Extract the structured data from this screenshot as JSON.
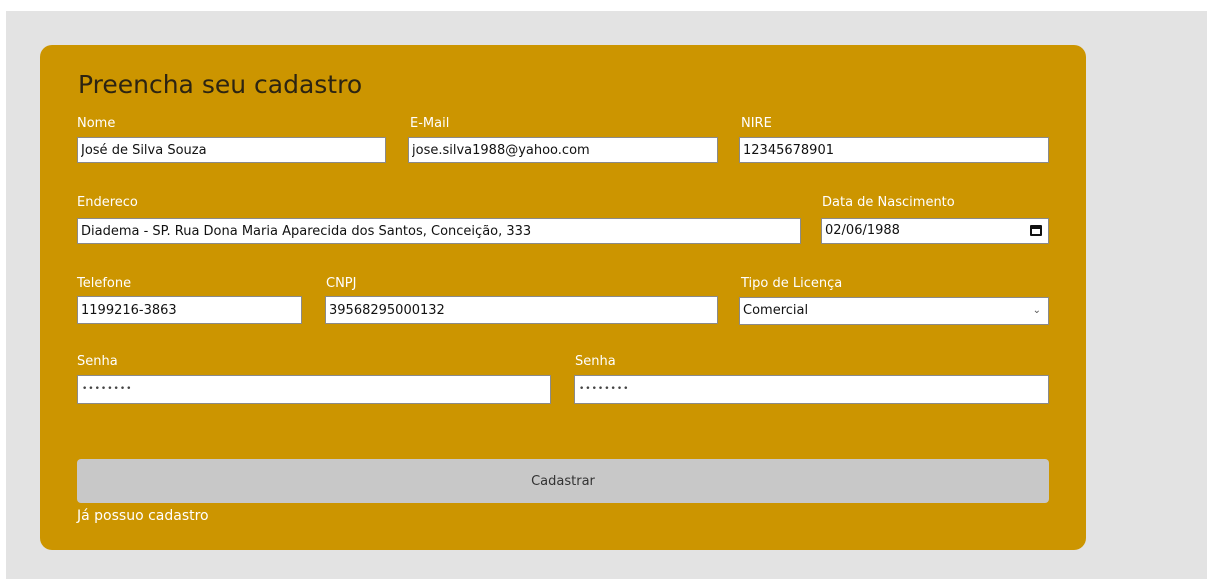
{
  "form": {
    "title": "Preencha seu cadastro",
    "fields": {
      "nome": {
        "label": "Nome",
        "value": "José de Silva Souza"
      },
      "email": {
        "label": "E-Mail",
        "value": "jose.silva1988@yahoo.com"
      },
      "nire": {
        "label": "NIRE",
        "value": "12345678901"
      },
      "endereco": {
        "label": "Endereco",
        "value": "Diadema - SP. Rua Dona Maria Aparecida dos Santos, Conceição, 333"
      },
      "nascimento": {
        "label": "Data de Nascimento",
        "value": "02/06/1988"
      },
      "telefone": {
        "label": "Telefone",
        "value": "1199216-3863"
      },
      "cnpj": {
        "label": "CNPJ",
        "value": "39568295000132"
      },
      "licenca": {
        "label": "Tipo de Licença",
        "value": "Comercial"
      },
      "senha": {
        "label": "Senha",
        "value": "••••••••"
      },
      "senha_confirm": {
        "label": "Senha",
        "value": "••••••••"
      }
    },
    "submit_label": "Cadastrar",
    "login_link": "Já possuo cadastro"
  },
  "colors": {
    "page_bg": "#e3e3e3",
    "card_bg": "#cc9500",
    "button_bg": "#c8c8c8"
  },
  "icons": {
    "date": "calendar-icon",
    "select": "chevron-down-icon"
  }
}
